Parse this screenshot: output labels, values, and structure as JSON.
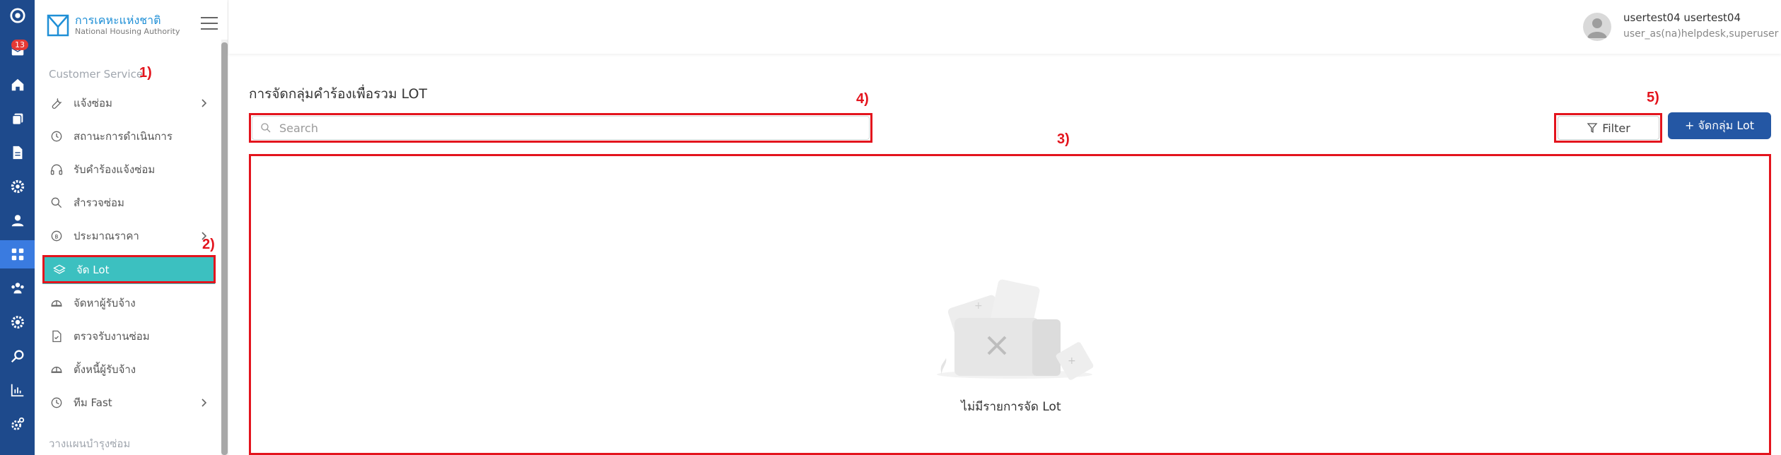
{
  "rail": {
    "badge": "13",
    "icons": [
      "logo-icon",
      "mail-icon",
      "home-icon",
      "copy-icon",
      "document-icon",
      "gear-icon",
      "user-icon",
      "dashboard-icon",
      "team-icon",
      "settings-icon",
      "search-icon",
      "chart-icon",
      "cog-icon"
    ]
  },
  "brand": {
    "name_th": "การเคหะแห่งชาติ",
    "name_en": "National Housing Authority"
  },
  "sidebar": {
    "section": "Customer Service",
    "items": [
      {
        "label": "แจ้งซ่อม",
        "icon": "wrench-icon",
        "has_submenu": true
      },
      {
        "label": "สถานะการดำเนินการ",
        "icon": "history-icon",
        "has_submenu": false
      },
      {
        "label": "รับคำร้องแจ้งซ่อม",
        "icon": "headset-icon",
        "has_submenu": false
      },
      {
        "label": "สำรวจซ่อม",
        "icon": "search-icon",
        "has_submenu": false
      },
      {
        "label": "ประมาณราคา",
        "icon": "price-icon",
        "has_submenu": true
      },
      {
        "label": "จัด Lot",
        "icon": "layers-icon",
        "has_submenu": false,
        "active": true
      },
      {
        "label": "จัดหาผู้รับจ้าง",
        "icon": "helmet-icon",
        "has_submenu": false
      },
      {
        "label": "ตรวจรับงานซ่อม",
        "icon": "doc-check-icon",
        "has_submenu": false
      },
      {
        "label": "ตั้งหนี้ผู้รับจ้าง",
        "icon": "helmet-icon",
        "has_submenu": false
      },
      {
        "label": "ทีม Fast",
        "icon": "clock-icon",
        "has_submenu": true
      }
    ],
    "section2": "วางแผนบำรุงซ่อม"
  },
  "user": {
    "name": "usertest04 usertest04",
    "role": "user_as(na)helpdesk,superuser"
  },
  "main": {
    "title": "การจัดกลุ่มคำร้องเพื่อรวม LOT",
    "search_placeholder": "Search",
    "filter_label": "Filter",
    "add_label": "+ จัดกลุ่ม Lot",
    "empty_text": "ไม่มีรายการจัด Lot"
  },
  "annotations": {
    "a1": "1)",
    "a2": "2)",
    "a3": "3)",
    "a4": "4)",
    "a5": "5)"
  },
  "colors": {
    "rail": "#1e4a8c",
    "active_item": "#3cc0c0",
    "primary_button": "#2457a4",
    "annotation": "#e3141d"
  }
}
